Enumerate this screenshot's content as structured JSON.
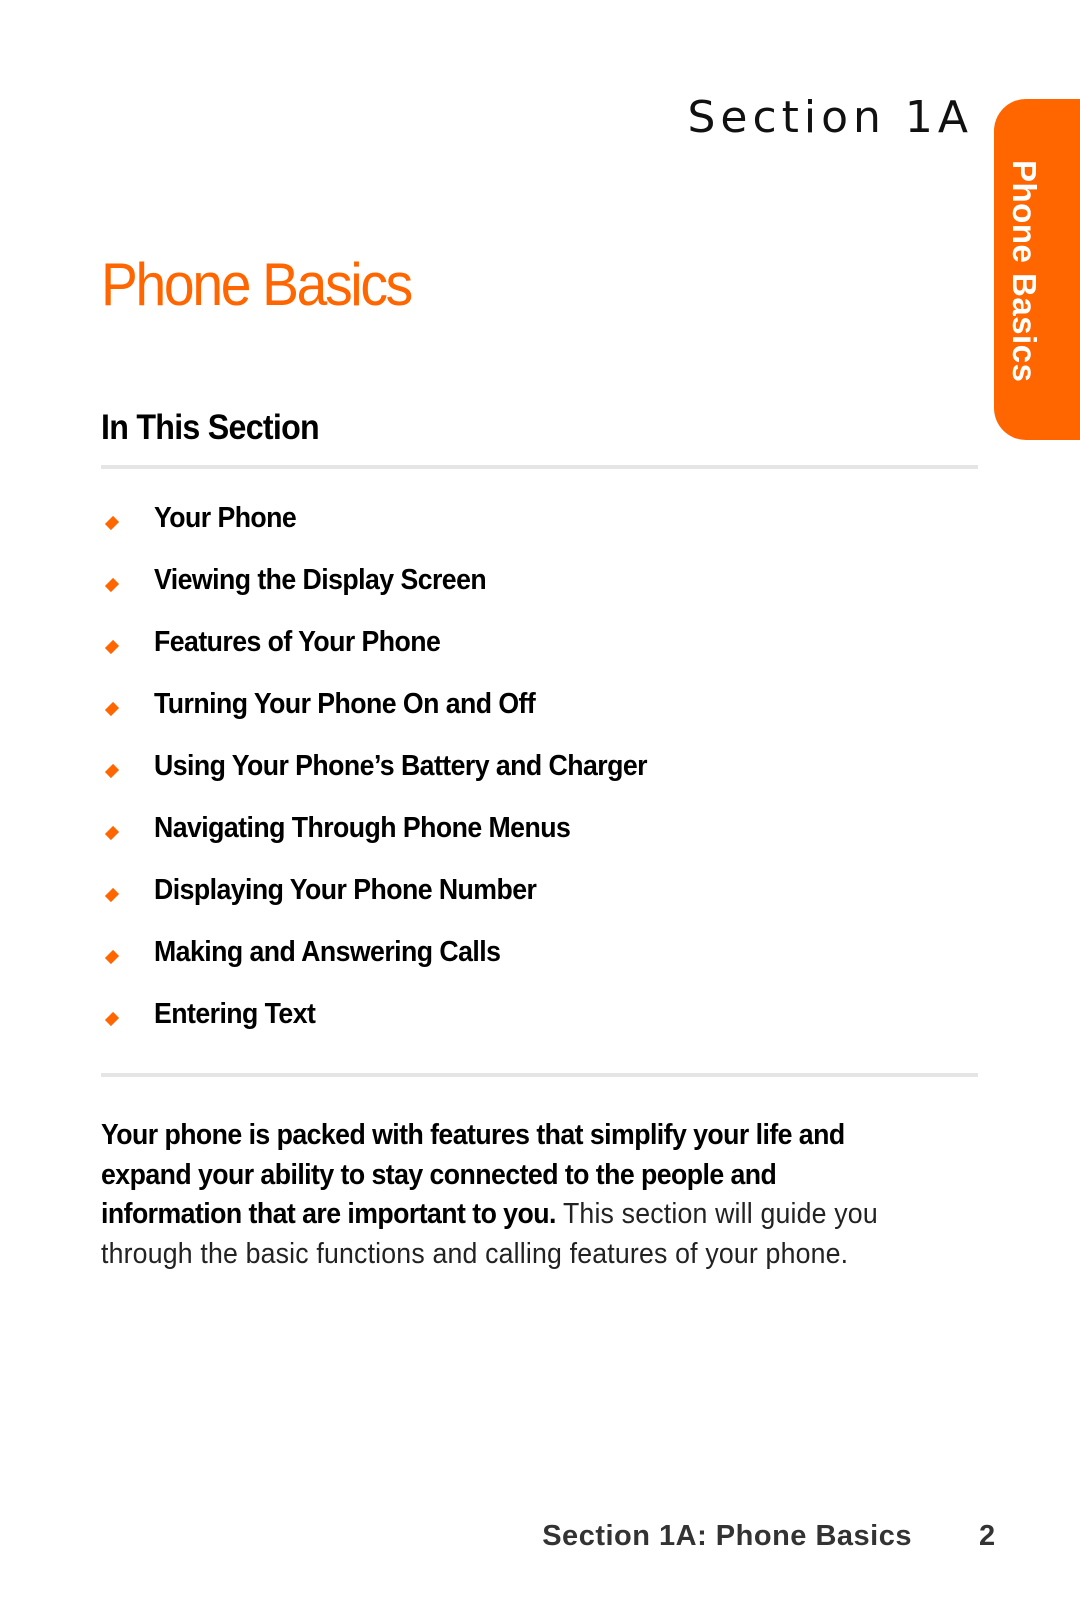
{
  "header": {
    "section_label": "Section 1A"
  },
  "side_tab": {
    "label": "Phone Basics",
    "color": "#ff6600"
  },
  "page": {
    "title": "Phone Basics",
    "subheading": "In This Section"
  },
  "topics": [
    {
      "label": "Your Phone",
      "icon": "diamond-bullet-icon"
    },
    {
      "label": "Viewing the Display Screen",
      "icon": "diamond-bullet-icon"
    },
    {
      "label": "Features of Your Phone",
      "icon": "diamond-bullet-icon"
    },
    {
      "label": "Turning Your Phone On and Off",
      "icon": "diamond-bullet-icon"
    },
    {
      "label": "Using Your Phone’s Battery and Charger",
      "icon": "diamond-bullet-icon"
    },
    {
      "label": "Navigating Through Phone Menus",
      "icon": "diamond-bullet-icon"
    },
    {
      "label": "Displaying Your Phone Number",
      "icon": "diamond-bullet-icon"
    },
    {
      "label": "Making and Answering Calls",
      "icon": "diamond-bullet-icon"
    },
    {
      "label": "Entering Text",
      "icon": "diamond-bullet-icon"
    }
  ],
  "intro": {
    "lead": "Your phone is packed with features that simplify your life and expand your ability to stay connected to the people and information that are important to you.",
    "rest": " This section will guide you through the basic functions and calling features of your phone."
  },
  "footer": {
    "title": "Section 1A: Phone Basics",
    "page_number": "2"
  },
  "colors": {
    "accent": "#ff6600",
    "divider": "#e5e5e5",
    "footer_text": "#333333"
  }
}
